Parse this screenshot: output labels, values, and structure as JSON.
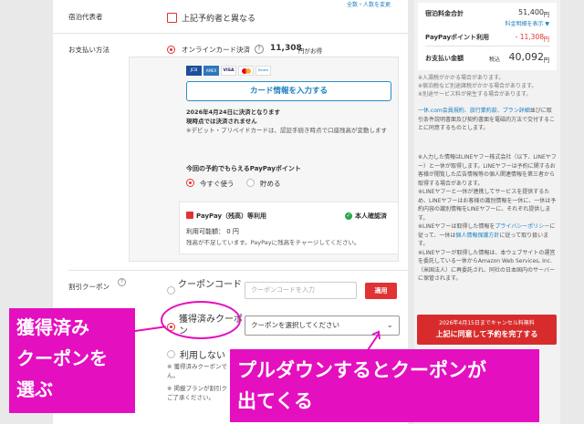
{
  "top_link": "全数・人数を変更",
  "guest": {
    "label": "宿泊代表者",
    "checkbox_label": "上記予約者と異なる"
  },
  "payment": {
    "label": "お支払い方法",
    "online_option": "オンラインカード決済",
    "help_icon": "?",
    "price": "11,308",
    "price_suffix": "円がお得",
    "card_brands": [
      "JCB",
      "AMEX",
      "VISA",
      "MC",
      "Diners"
    ],
    "card_button": "カード情報を入力する",
    "settle_date": "2026年4月24日に決済となります",
    "settle_note": "現時点では決済されません",
    "debit_note": "※デビット・プリペイドカードは、認証手続き時点で口座残高が変動します",
    "points_title": "今回の予約でもらえるPayPayポイント",
    "use_now": "今すぐ使う",
    "save": "貯める",
    "paypay_title": "PayPay（残高）等利用",
    "verified": "本人確認済",
    "available": "利用可能額： 0 円",
    "balance_note": "残高が不足しています。PayPayに残高をチャージしてください。"
  },
  "coupon": {
    "label": "割引クーポン",
    "code_option": "クーポンコード",
    "code_placeholder": "クーポンコードを入力",
    "apply": "適用",
    "acquired_option": "獲得済みクーポン",
    "select_placeholder": "クーポンを選択してください",
    "none_option": "利用しない",
    "note1": "※ 獲得済みクーポンで",
    "note2": "ん。",
    "note3": "※ 掲載プランが割引ク",
    "note4": "ご了承ください。"
  },
  "summary": {
    "total_label": "宿泊料金合計",
    "total_value": "51,400",
    "total_unit": "円",
    "detail_link": "料金明細を表示 ▼",
    "points_label": "PayPayポイント利用",
    "points_value": "- 11,308",
    "points_unit": "円",
    "pay_label": "お支払い金額",
    "pay_prefix": "税込",
    "pay_value": "40,092",
    "pay_unit": "円"
  },
  "side_notes": {
    "n1": "※入湯税がかかる場合があります。",
    "n2": "※宿泊税など別途諸税がかかる場合があります。",
    "n3": "※別途サービス料が発生する場合があります。",
    "terms_pre": "一休.com会員規約、",
    "terms_link2": "旅行業約款、",
    "terms_link3": "プラン詳細",
    "terms_body": "並びに取引条件説明書面及び契約書面を電磁的方法で交付することに同意するものとします。",
    "line1": "※入力した情報はLINEヤフー株式会社（以下、LINEヤフー）と一休が取得します。LINEヤフーは予約に関するお客様が閲覧した広告情報等の個人関連情報を第三者から取得する場合があります。",
    "line2": "※LINEヤフーと一休が連携してサービスを提供するため、LINEヤフーはお客様の識別情報を一休に、一休は予約内容の識別情報をLINEヤフーに、それぞれ提供します。",
    "line3_pre": "※LINEヤフーは取得した情報を",
    "line3_link": "プライバシーポリシー",
    "line3_mid": "に従って、一休は",
    "line3_link2": "個人情報保護方針",
    "line3_post": "に従って取り扱います。",
    "line4": "※LINEヤフーが取得した情報は、本ウェブサイトの運営を委託している一休からAmazon Web Services, Inc.（米国法人）に再委託され、同社の日本国内のサーバーに保管されます。"
  },
  "cta": {
    "notice": "2026年4月15日までキャンセル料無料",
    "label": "上記に同意して予約を完了する"
  },
  "annotations": {
    "left_line1": "獲得済み",
    "left_line2": "クーポンを",
    "left_line3": "選ぶ",
    "right_line1": "プルダウンするとクーポンが",
    "right_line2": "出てくる"
  },
  "colors": {
    "accent_red": "#e03333",
    "link_blue": "#1a7fc1",
    "annotation_magenta": "#e40fbf"
  }
}
